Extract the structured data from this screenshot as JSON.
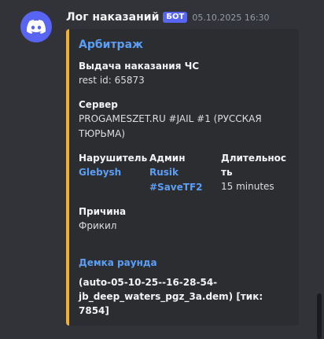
{
  "message": {
    "author": "Лог наказаний",
    "bot_badge": "БОТ",
    "timestamp": "05.10.2025 16:30",
    "avatar_icon": "discord-logo-icon",
    "colors": {
      "avatar_bg": "#5865f2",
      "embed_accent": "#f0b132",
      "link": "#5d9ef5"
    }
  },
  "embed": {
    "title": "Арбитраж",
    "punishment": {
      "name": "Выдача наказания ЧС",
      "value": "rest id: 65873"
    },
    "server": {
      "name": "Сервер",
      "value": "PROGAMESZET.RU #JAIL #1 (РУССКАЯ ТЮРЬМА)"
    },
    "violator": {
      "name": "Нарушитель",
      "value": "Glebysh"
    },
    "admin": {
      "name": "Админ",
      "value_line1": "Rusik",
      "value_line2": "#SaveTF2"
    },
    "duration": {
      "name": "Длительность",
      "value": "15 minutes"
    },
    "reason": {
      "name": "Причина",
      "value": "Фрикил"
    },
    "demo": {
      "title": "Демка раунда",
      "text": "(auto-05-10-25--16-28-54-jb_deep_waters_pgz_3a.dem) [тик: 7854]"
    }
  }
}
